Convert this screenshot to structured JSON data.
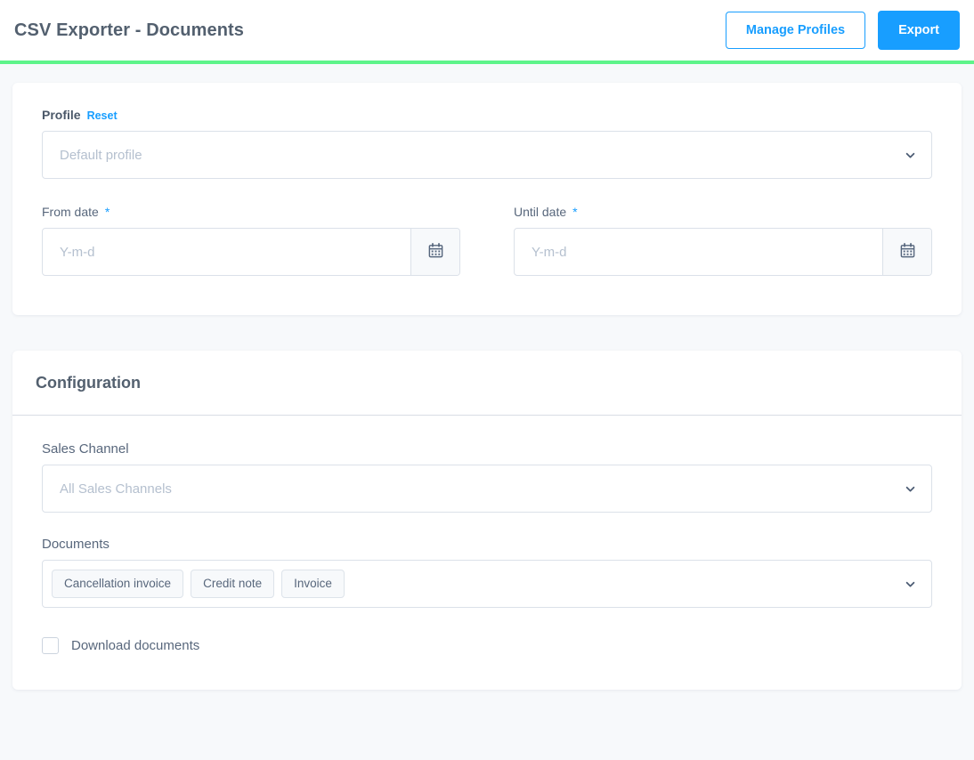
{
  "header": {
    "title": "CSV Exporter - Documents",
    "manage_profiles_label": "Manage Profiles",
    "export_label": "Export",
    "accent_color": "#5ef48a",
    "primary_color": "#189eff"
  },
  "profile_card": {
    "profile_label": "Profile",
    "reset_label": "Reset",
    "profile_select": {
      "placeholder": "Default profile",
      "value": "",
      "icon": "chevron-down-icon"
    },
    "from_date": {
      "label": "From date",
      "required_marker": "*",
      "placeholder": "Y-m-d",
      "value": "",
      "icon": "calendar-icon"
    },
    "until_date": {
      "label": "Until date",
      "required_marker": "*",
      "placeholder": "Y-m-d",
      "value": "",
      "icon": "calendar-icon"
    }
  },
  "configuration_card": {
    "title": "Configuration",
    "sales_channel": {
      "label": "Sales Channel",
      "placeholder": "All Sales Channels",
      "value": "",
      "icon": "chevron-down-icon"
    },
    "documents": {
      "label": "Documents",
      "selected": [
        "Cancellation invoice",
        "Credit note",
        "Invoice"
      ],
      "icon": "chevron-down-icon"
    },
    "download_documents": {
      "label": "Download documents",
      "checked": false
    }
  }
}
